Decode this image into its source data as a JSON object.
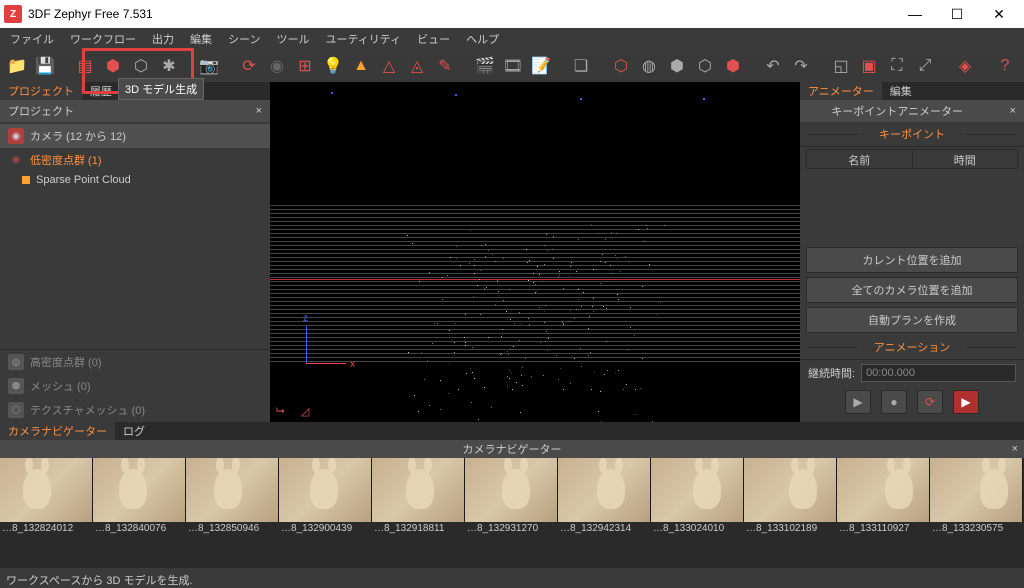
{
  "app": {
    "title": "3DF Zephyr Free 7.531"
  },
  "menu": [
    "ファイル",
    "ワークフロー",
    "出力",
    "編集",
    "シーン",
    "ツール",
    "ユーティリティ",
    "ビュー",
    "ヘルプ"
  ],
  "tooltip": "3D モデル生成",
  "left_tabs": [
    "プロジェクト",
    "履歴"
  ],
  "project_panel": {
    "title": "プロジェクト"
  },
  "tree": {
    "cameras": "カメラ (12 から 12)",
    "sparse": "低密度点群 (1)",
    "sparse_child": "Sparse Point Cloud",
    "dense": "高密度点群 (0)",
    "mesh": "メッシュ (0)",
    "tex": "テクスチャメッシュ (0)"
  },
  "right_tabs": [
    "アニメーター",
    "編集"
  ],
  "animator": {
    "title": "キーポイントアニメーター",
    "section1": "キーポイント",
    "col_name": "名前",
    "col_time": "時間",
    "btn_current": "カレント位置を追加",
    "btn_allcam": "全てのカメラ位置を追加",
    "btn_autoplan": "自動プランを作成",
    "section2": "アニメーション",
    "duration_label": "継続時間:",
    "duration_value": "00:00.000"
  },
  "bottom_tabs": [
    "カメラナビゲーター",
    "ログ"
  ],
  "navigator_title": "カメラナビゲーター",
  "thumbs": [
    "…8_132824012",
    "…8_132840076",
    "…8_132850946",
    "…8_132900439",
    "…8_132918811",
    "…8_132931270",
    "…8_132942314",
    "…8_133024010",
    "…8_133102189",
    "…8_133110927",
    "…8_133230575"
  ],
  "status": "ワークスペースから 3D モデルを生成."
}
